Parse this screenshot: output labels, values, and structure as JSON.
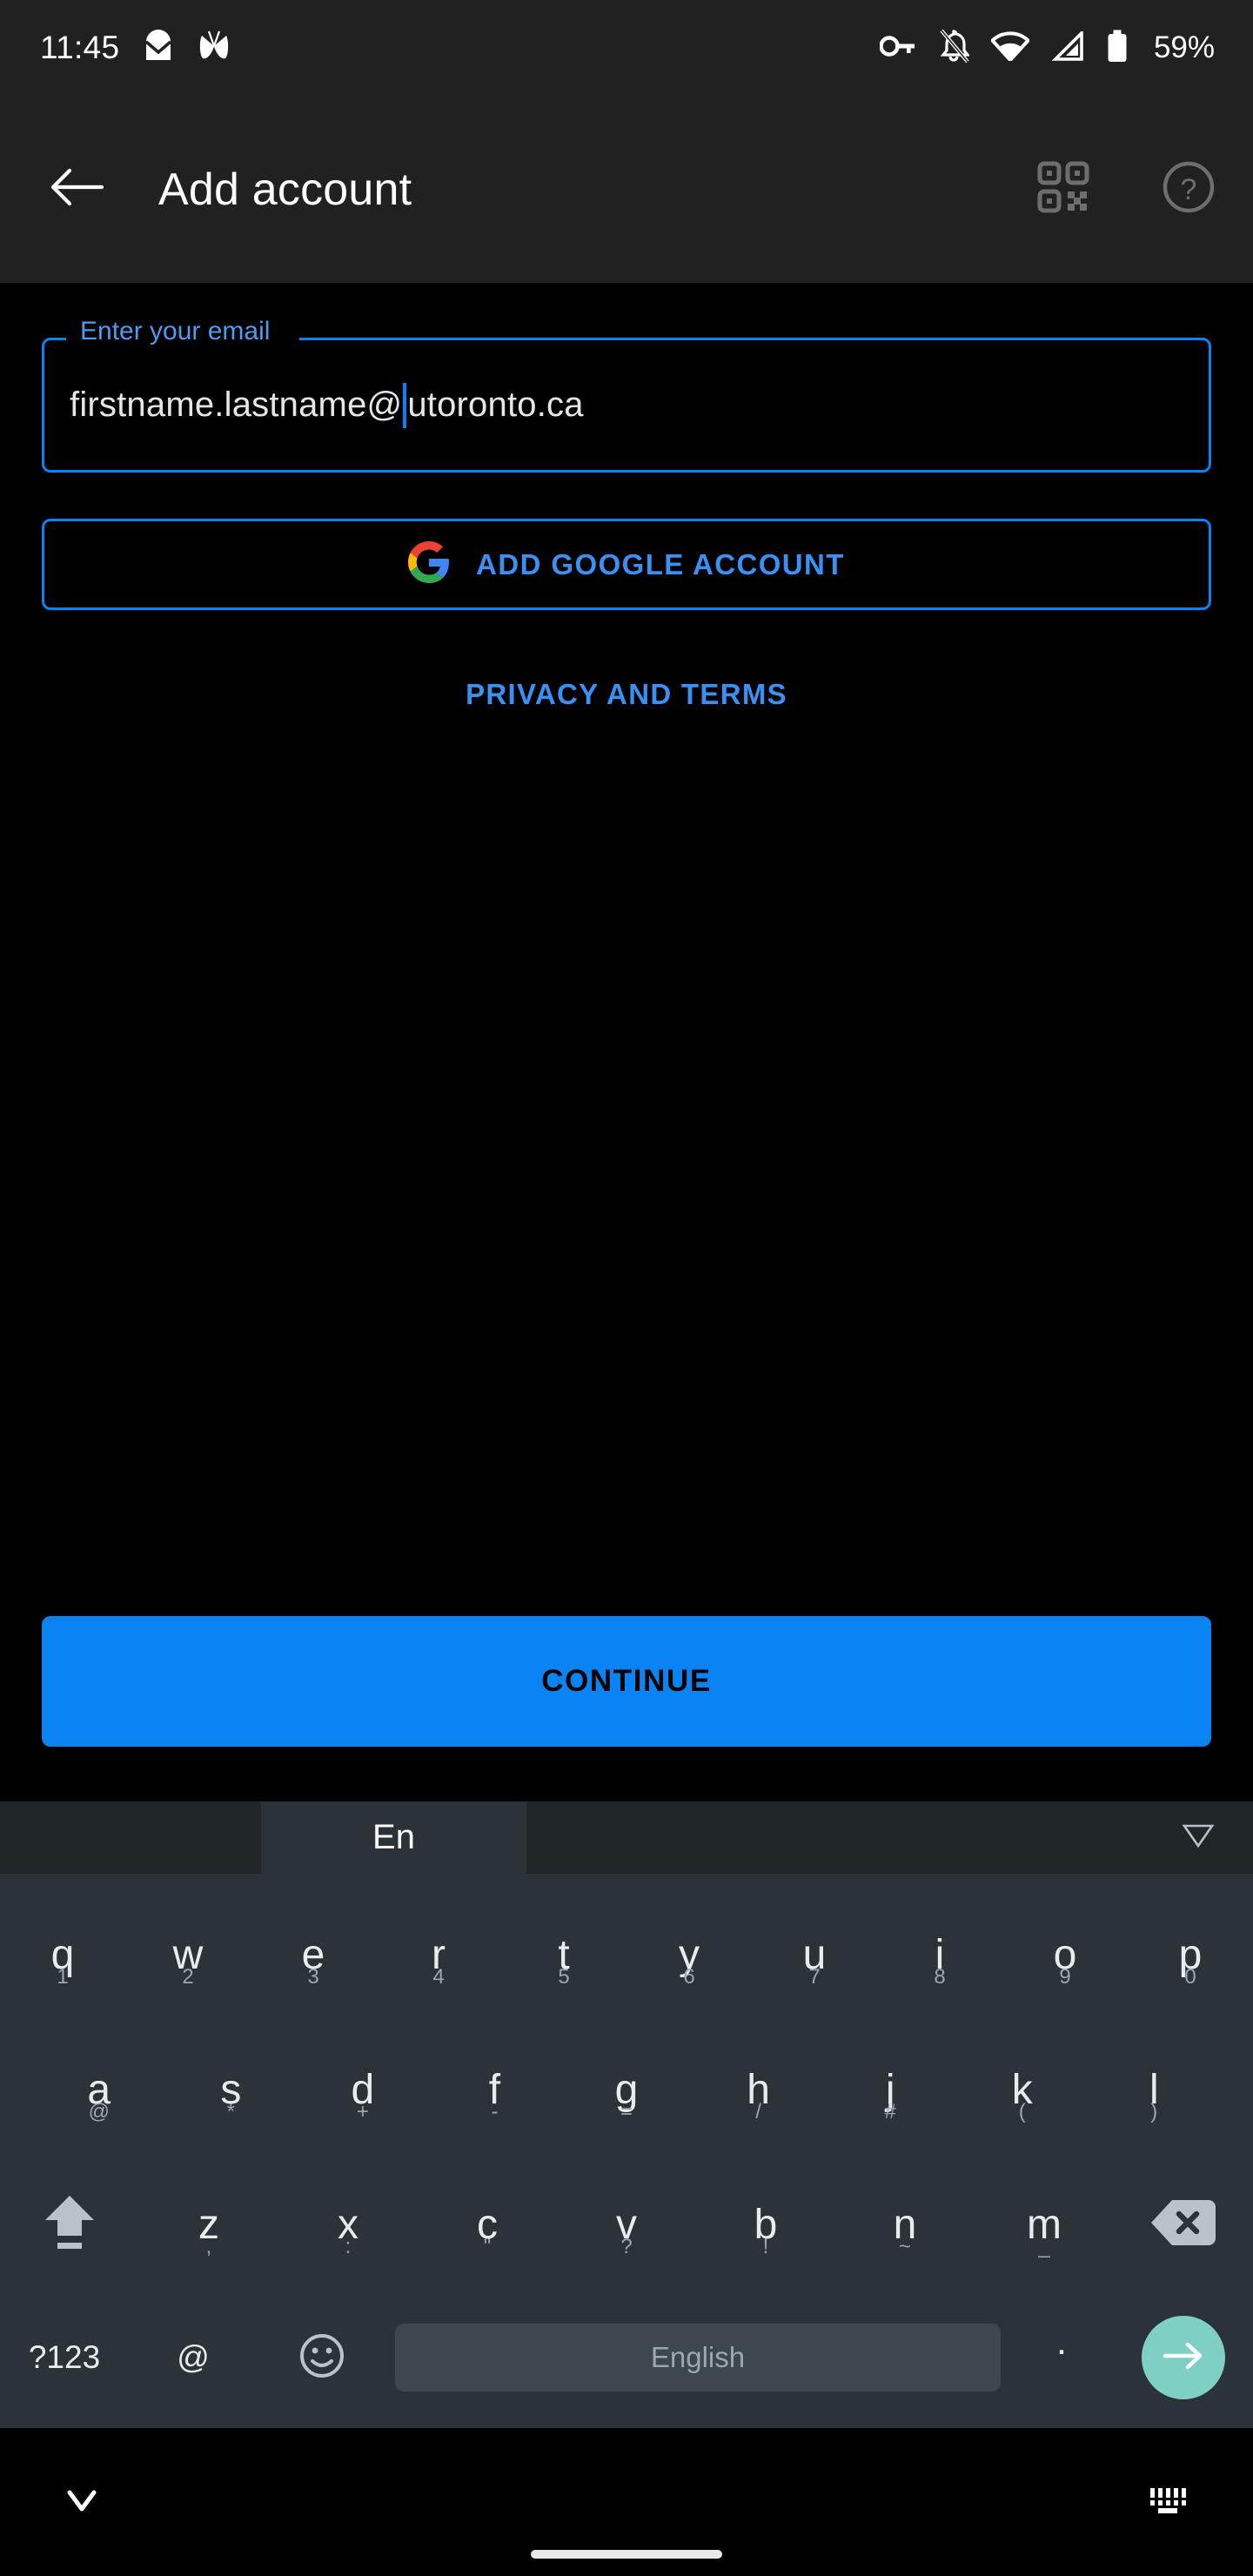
{
  "status_bar": {
    "time": "11:45",
    "icons_left": [
      "mail-icon",
      "butterfly-icon"
    ],
    "icons_right": [
      "vpn-key-icon",
      "notifications-off-icon",
      "wifi-icon",
      "cellular-signal-icon",
      "battery-icon"
    ],
    "battery_percent": "59%"
  },
  "app_bar": {
    "back_icon": "back-arrow-icon",
    "title": "Add account",
    "qr_icon": "qr-code-scanner-icon",
    "help_icon": "help-circle-icon"
  },
  "form": {
    "email_field": {
      "label": "Enter your email",
      "value": "firstname.lastname@utoronto.ca",
      "value_before_caret": "firstname.lastname@",
      "value_after_caret": "utoronto.ca",
      "placeholder": "Enter your email"
    },
    "google_button": {
      "label": "ADD GOOGLE ACCOUNT",
      "icon": "google-g-icon"
    },
    "privacy_link": "PRIVACY AND TERMS",
    "continue_button": "CONTINUE"
  },
  "colors": {
    "accent_blue": "#0b84f3",
    "link_blue": "#3a91f5",
    "label_blue": "#4f9bf0",
    "keyboard_bg": "#2b3339",
    "suggestion_bg": "#212629",
    "enter_teal": "#7ecfc4",
    "appbar_bg": "#212121",
    "page_bg": "#000000"
  },
  "keyboard": {
    "suggestion_bar": {
      "active_label": "En",
      "collapse_icon": "collapse-triangle-icon"
    },
    "row1": [
      {
        "key": "q",
        "hint": "1"
      },
      {
        "key": "w",
        "hint": "2"
      },
      {
        "key": "e",
        "hint": "3"
      },
      {
        "key": "r",
        "hint": "4"
      },
      {
        "key": "t",
        "hint": "5"
      },
      {
        "key": "y",
        "hint": "6"
      },
      {
        "key": "u",
        "hint": "7"
      },
      {
        "key": "i",
        "hint": "8"
      },
      {
        "key": "o",
        "hint": "9"
      },
      {
        "key": "p",
        "hint": "0"
      }
    ],
    "row2": [
      {
        "key": "a",
        "hint": "@"
      },
      {
        "key": "s",
        "hint": "*"
      },
      {
        "key": "d",
        "hint": "+"
      },
      {
        "key": "f",
        "hint": "-"
      },
      {
        "key": "g",
        "hint": "="
      },
      {
        "key": "h",
        "hint": "/"
      },
      {
        "key": "j",
        "hint": "#"
      },
      {
        "key": "k",
        "hint": "("
      },
      {
        "key": "l",
        "hint": ")"
      }
    ],
    "row3": [
      {
        "key": "z",
        "hint": ","
      },
      {
        "key": "x",
        "hint": ":"
      },
      {
        "key": "c",
        "hint": "\""
      },
      {
        "key": "v",
        "hint": "?"
      },
      {
        "key": "b",
        "hint": "!"
      },
      {
        "key": "n",
        "hint": "~"
      },
      {
        "key": "m",
        "hint": "_"
      }
    ],
    "shift_key": "shift-icon",
    "backspace_key": "backspace-icon",
    "row4": {
      "symbols_label": "?123",
      "at_label": "@",
      "emoji_icon": "emoji-smiley-icon",
      "space_label": "English",
      "period_label": ".",
      "enter_icon": "enter-arrow-icon"
    }
  },
  "nav_bar": {
    "hide_keyboard_icon": "chevron-down-icon",
    "keyboard_switcher_icon": "keyboard-icon",
    "home_indicator": "home-gesture-pill"
  }
}
